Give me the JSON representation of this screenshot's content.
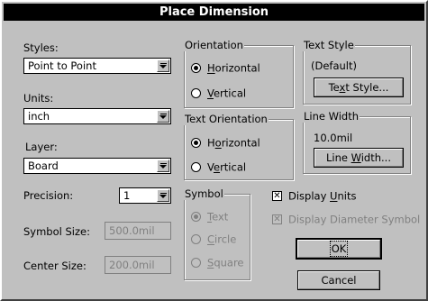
{
  "dialog": {
    "title": "Place Dimension"
  },
  "styles": {
    "label": "Styles:",
    "value": "Point to Point"
  },
  "units": {
    "label": "Units:",
    "value": "inch"
  },
  "layer": {
    "label": "Layer:",
    "value": "Board"
  },
  "precision": {
    "label": "Precision:",
    "value": "1"
  },
  "symbol_size": {
    "label": "Symbol Size:",
    "value": "500.0mil"
  },
  "center_size": {
    "label": "Center Size:",
    "value": "200.0mil"
  },
  "orientation": {
    "title": "Orientation",
    "options": [
      {
        "pre": "",
        "key": "H",
        "post": "orizontal",
        "selected": true
      },
      {
        "pre": "",
        "key": "V",
        "post": "ertical",
        "selected": false
      }
    ]
  },
  "text_orientation": {
    "title": "Text Orientation",
    "options": [
      {
        "pre": "H",
        "key": "o",
        "post": "rizontal",
        "selected": true
      },
      {
        "pre": "V",
        "key": "e",
        "post": "rtical",
        "selected": false
      }
    ]
  },
  "symbol": {
    "title": "Symbol",
    "options": [
      {
        "pre": "",
        "key": "T",
        "post": "ext",
        "selected": true
      },
      {
        "pre": "",
        "key": "C",
        "post": "ircle",
        "selected": false
      },
      {
        "pre": "",
        "key": "S",
        "post": "quare",
        "selected": false
      }
    ]
  },
  "text_style": {
    "title": "Text Style",
    "value": "(Default)",
    "button_pre": "Te",
    "button_key": "x",
    "button_post": "t Style..."
  },
  "line_width": {
    "title": "Line Width",
    "value": "10.0mil",
    "button_pre": "Line ",
    "button_key": "W",
    "button_post": "idth..."
  },
  "display_units": {
    "pre": "Display ",
    "key": "U",
    "post": "nits",
    "checked": true
  },
  "display_diameter": {
    "label": "Display Diameter Symbol",
    "checked": true
  },
  "buttons": {
    "ok": "OK",
    "cancel": "Cancel"
  }
}
